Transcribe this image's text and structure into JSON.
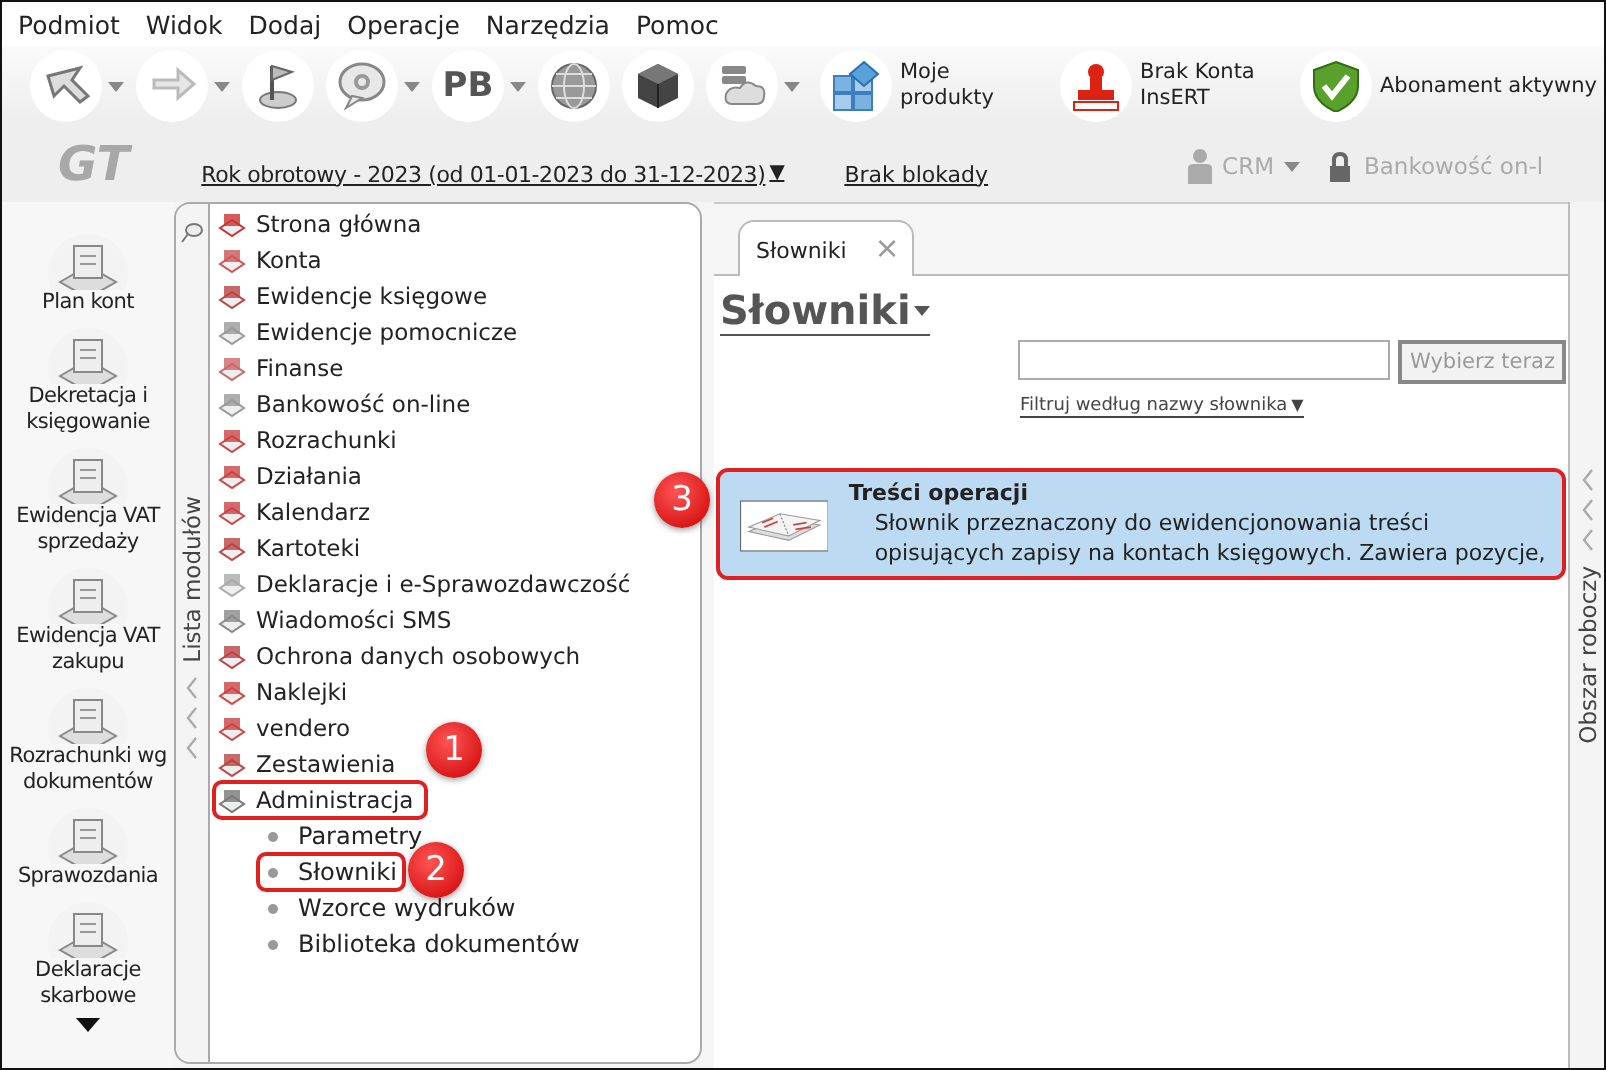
{
  "menu": [
    "Podmiot",
    "Widok",
    "Dodaj",
    "Operacje",
    "Narzędzia",
    "Pomoc"
  ],
  "toolbar": [
    {
      "kind": "icon",
      "caret": true
    },
    {
      "kind": "icon",
      "caret": true
    },
    {
      "kind": "icon",
      "caret": false
    },
    {
      "kind": "icon",
      "caret": true
    },
    {
      "kind": "text",
      "text": "PB",
      "caret": true
    },
    {
      "kind": "icon",
      "caret": false
    },
    {
      "kind": "icon",
      "caret": false
    },
    {
      "kind": "icon",
      "caret": true
    },
    {
      "kind": "labeled",
      "label": "Moje produkty"
    },
    {
      "kind": "labeled",
      "label": "Brak Konta InsERT"
    },
    {
      "kind": "labeled",
      "label": "Abonament aktywny"
    }
  ],
  "header": {
    "logo": "GT",
    "period": "Rok obrotowy - 2023  (od 01-01-2023 do 31-12-2023)",
    "period_caret": "▼",
    "lock": "Brak blokady",
    "crm": "CRM",
    "banking": "Bankowość on-l"
  },
  "shortcuts": [
    {
      "label": "Plan kont"
    },
    {
      "label": "Dekretacja i księgowanie"
    },
    {
      "label": "Ewidencja VAT sprzedaży"
    },
    {
      "label": "Ewidencja VAT zakupu"
    },
    {
      "label": "Rozrachunki wg dokumentów"
    },
    {
      "label": "Sprawozdania"
    },
    {
      "label": "Deklaracje skarbowe"
    }
  ],
  "module_strip": {
    "title": "Lista modułów"
  },
  "modules": [
    {
      "label": "Strona główna",
      "highlighted": false
    },
    {
      "label": "Konta",
      "highlighted": false
    },
    {
      "label": "Ewidencje księgowe",
      "highlighted": false
    },
    {
      "label": "Ewidencje pomocnicze",
      "highlighted": false
    },
    {
      "label": "Finanse",
      "highlighted": false
    },
    {
      "label": "Bankowość on-line",
      "highlighted": false
    },
    {
      "label": "Rozrachunki",
      "highlighted": false
    },
    {
      "label": "Działania",
      "highlighted": false
    },
    {
      "label": "Kalendarz",
      "highlighted": false
    },
    {
      "label": "Kartoteki",
      "highlighted": false
    },
    {
      "label": "Deklaracje i e-Sprawozdawczość",
      "highlighted": false
    },
    {
      "label": "Wiadomości SMS",
      "highlighted": false
    },
    {
      "label": "Ochrona danych osobowych",
      "highlighted": false
    },
    {
      "label": "Naklejki",
      "highlighted": false
    },
    {
      "label": "vendero",
      "highlighted": false
    },
    {
      "label": "Zestawienia",
      "highlighted": false
    },
    {
      "label": "Administracja",
      "highlighted": true,
      "children": [
        {
          "label": "Parametry",
          "highlighted": false
        },
        {
          "label": "Słowniki",
          "highlighted": true
        },
        {
          "label": "Wzorce wydruków",
          "highlighted": false
        },
        {
          "label": "Biblioteka dokumentów",
          "highlighted": false
        }
      ]
    }
  ],
  "tabs": [
    {
      "label": "Słowniki",
      "selected": true,
      "close": "×"
    }
  ],
  "page": {
    "title": "Słowniki",
    "search_button": "Wybierz teraz",
    "filter": "Filtruj według nazwy słownika",
    "filter_caret": "▼"
  },
  "dictionaries": [
    {
      "title": "Treści operacji",
      "description": "Słownik przeznaczony do ewidencjonowania treści opisujących zapisy na kontach księgowych. Zawiera pozycje,",
      "selected": true,
      "highlighted": true
    }
  ],
  "work_strip": {
    "title": "Obszar roboczy"
  },
  "callouts": [
    {
      "number": "1"
    },
    {
      "number": "2"
    },
    {
      "number": "3"
    }
  ]
}
